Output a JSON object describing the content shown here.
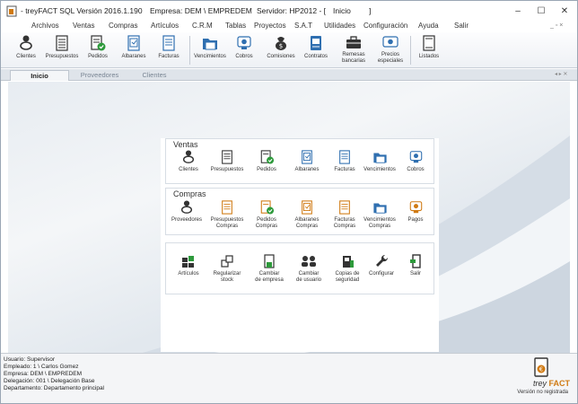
{
  "titlebar": {
    "app": "- treyFACT SQL Versión 2016.1.190",
    "empresa": "Empresa: DEM \\ EMPREDEM",
    "servidor": "Servidor: HP2012 - [",
    "vista": "Inicio",
    "bracket": "]",
    "min": "–",
    "max": "☐",
    "close": "✕"
  },
  "menu": {
    "items": [
      "Archivos",
      "Ventas",
      "Compras",
      "Artículos",
      "C.R.M",
      "Tablas",
      "Proyectos",
      "S.A.T",
      "Utilidades",
      "Configuración",
      "Ayuda",
      "Salir"
    ],
    "mdi": "_ ▫ ×"
  },
  "ribbon": {
    "buttons": [
      {
        "label": "Clientes",
        "icon": "clients-icon"
      },
      {
        "label": "Presupuestos",
        "icon": "budget-icon"
      },
      {
        "label": "Pedidos",
        "icon": "orders-icon"
      },
      {
        "label": "Albaranes",
        "icon": "delivery-note-icon"
      },
      {
        "label": "Facturas",
        "icon": "invoice-icon"
      },
      {
        "label": "Vencimientos",
        "icon": "due-dates-icon"
      },
      {
        "label": "Cobros",
        "icon": "collections-icon"
      },
      {
        "label": "Comisiones",
        "icon": "commissions-icon"
      },
      {
        "label": "Contratos",
        "icon": "contracts-icon"
      },
      {
        "label": "Remesas\nbancarias",
        "icon": "bank-remittance-icon"
      },
      {
        "label": "Precios\nespeciales",
        "icon": "special-prices-icon"
      },
      {
        "label": "Listados",
        "icon": "listings-icon"
      }
    ]
  },
  "tabs": {
    "items": [
      "Inicio",
      "Proveedores",
      "Clientes"
    ],
    "nav": "◂ ▸ ✕"
  },
  "launcher": {
    "ventas": {
      "title": "Ventas",
      "buttons": [
        "Clientes",
        "Presupuestos",
        "Pedidos",
        "Albaranes",
        "Facturas",
        "Vencimientos",
        "Cobros"
      ]
    },
    "compras": {
      "title": "Compras",
      "buttons": [
        "Proveedores",
        "Presupuestos\nCompras",
        "Pedidos\nCompras",
        "Albaranes\nCompras",
        "Facturas\nCompras",
        "Vencimientos\nCompras",
        "Pagos"
      ]
    },
    "utilidades": {
      "buttons": [
        "Artículos",
        "Regularizar\nstock",
        "Cambiar\nde empresa",
        "Cambiar\nde usuario",
        "Copias de\nseguridad",
        "Configurar",
        "Salir"
      ]
    }
  },
  "status": {
    "usuario": "Usuario: Supervisor",
    "empleado": "Empleado: 1 \\  Carlos Gomez",
    "empresa": "Empresa: DEM \\  EMPREDEM",
    "delegacion": "Delegación: 001 \\  Delegación Base",
    "departamento": "Departamento: Departamento principal"
  },
  "brand": {
    "prefix": "trey",
    "name": "FACT",
    "note": "Versión no registrada"
  },
  "colors": {
    "accent": "#d07a12",
    "blue": "#2f6fb0",
    "green": "#2d9a3b"
  }
}
